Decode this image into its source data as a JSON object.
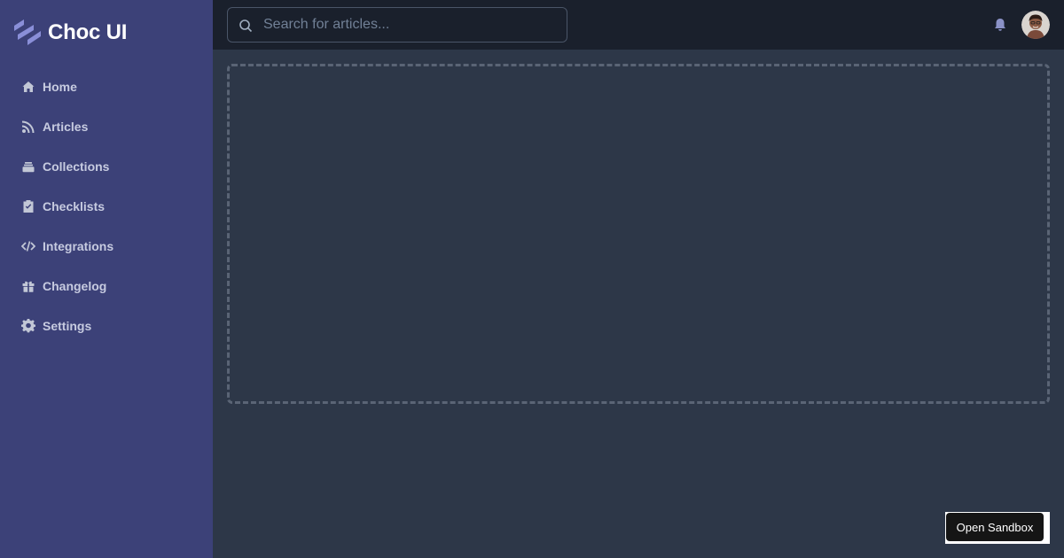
{
  "app": {
    "brand_name": "Choc UI",
    "brand_icon": "logo-stripes-icon"
  },
  "sidebar": {
    "items": [
      {
        "label": "Home",
        "icon": "home-icon"
      },
      {
        "label": "Articles",
        "icon": "rss-icon"
      },
      {
        "label": "Collections",
        "icon": "collections-icon"
      },
      {
        "label": "Checklists",
        "icon": "clipboard-check-icon"
      },
      {
        "label": "Integrations",
        "icon": "code-icon"
      },
      {
        "label": "Changelog",
        "icon": "gift-icon"
      },
      {
        "label": "Settings",
        "icon": "gear-icon"
      }
    ]
  },
  "header": {
    "search": {
      "placeholder": "Search for articles...",
      "value": "",
      "icon": "search-icon"
    },
    "notification_icon": "bell-icon",
    "avatar_icon": "user-avatar"
  },
  "footer": {
    "sandbox_label": "Open Sandbox"
  },
  "colors": {
    "sidebar_bg": "#3c4178",
    "topbar_bg": "#1a202c",
    "main_bg": "#2d3748",
    "accent": "#8b92c7"
  }
}
